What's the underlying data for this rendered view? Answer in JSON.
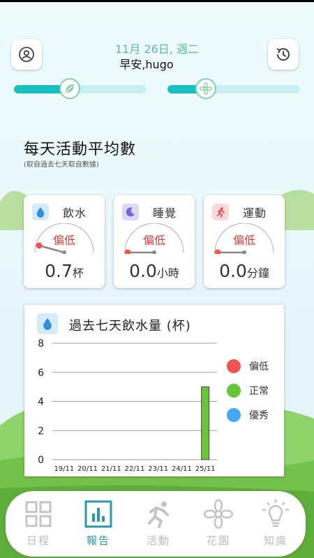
{
  "header": {
    "date": "11月 26日, 週二",
    "greeting": "早安,hugo"
  },
  "progress": {
    "left_fraction": 0.42,
    "right_fraction": 0.29
  },
  "section": {
    "title": "每天活動平均數",
    "subtitle": "(取自過去七天取自數據)"
  },
  "stats": [
    {
      "name": "飲水",
      "level": "偏低",
      "value": "0.7",
      "unit": "杯",
      "icon": "water-drop-icon",
      "icon_bg": "#d3eafc"
    },
    {
      "name": "睡覺",
      "level": "偏低",
      "value": "0.0",
      "unit": "小時",
      "icon": "moon-icon",
      "icon_bg": "#ded8f7"
    },
    {
      "name": "運動",
      "level": "偏低",
      "value": "0.0",
      "unit": "分鐘",
      "icon": "runner-icon",
      "icon_bg": "#fbd9d9"
    }
  ],
  "chart_data": {
    "type": "bar",
    "title": "過去七天飲水量 (杯)",
    "categories": [
      "19/11",
      "20/11",
      "21/11",
      "22/11",
      "23/11",
      "24/11",
      "25/11"
    ],
    "values": [
      0,
      0,
      0,
      0,
      0,
      0,
      5
    ],
    "ylim": [
      0,
      8
    ],
    "yticks": [
      "0",
      "2",
      "4",
      "6",
      "8"
    ],
    "grid": true,
    "legend": [
      {
        "label": "偏低",
        "color": "#ef5454"
      },
      {
        "label": "正常",
        "color": "#6ac43a"
      },
      {
        "label": "優秀",
        "color": "#45a9f2"
      }
    ],
    "legend_position": "right",
    "bar_color": "#6ac43a"
  },
  "tabs": [
    {
      "label": "日程",
      "icon": "grid-icon",
      "active": false
    },
    {
      "label": "報告",
      "icon": "bar-chart-icon",
      "active": true
    },
    {
      "label": "活動",
      "icon": "runner-icon",
      "active": false
    },
    {
      "label": "花園",
      "icon": "flower-icon",
      "active": false
    },
    {
      "label": "知識",
      "icon": "lightbulb-icon",
      "active": false
    }
  ],
  "colors": {
    "accent": "#18c1bf",
    "low": "#e83b3b",
    "date": "#5fb9a4"
  }
}
